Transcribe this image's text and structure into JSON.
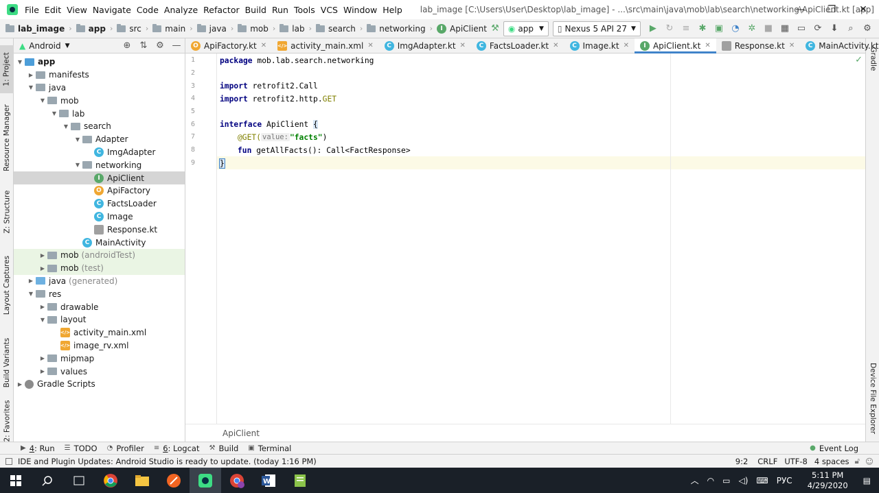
{
  "titlebar": {
    "menu": [
      "File",
      "Edit",
      "View",
      "Navigate",
      "Code",
      "Analyze",
      "Refactor",
      "Build",
      "Run",
      "Tools",
      "VCS",
      "Window",
      "Help"
    ],
    "window_title": "lab_image [C:\\Users\\User\\Desktop\\lab_image] - ...\\src\\main\\java\\mob\\lab\\search\\networking\\ApiClient.kt [app]",
    "controls": {
      "minimize": "—",
      "restore": "❐",
      "close": "✕"
    }
  },
  "navbar": {
    "crumbs": [
      "lab_image",
      "app",
      "src",
      "main",
      "java",
      "mob",
      "lab",
      "search",
      "networking",
      "ApiClient"
    ],
    "run_config": "app",
    "device": "Nexus 5 API 27"
  },
  "left_stripe": [
    "1: Project",
    "Resource Manager",
    "Z: Structure",
    "Layout Captures",
    "Build Variants",
    "2: Favorites"
  ],
  "right_stripe": [
    "Gradle",
    "Device File Explorer"
  ],
  "project_panel": {
    "view": "Android",
    "tree": [
      {
        "label": "app",
        "bold": true
      },
      {
        "label": "manifests"
      },
      {
        "label": "java"
      },
      {
        "label": "mob"
      },
      {
        "label": "lab"
      },
      {
        "label": "search"
      },
      {
        "label": "Adapter"
      },
      {
        "label": "ImgAdapter"
      },
      {
        "label": "networking"
      },
      {
        "label": "ApiClient"
      },
      {
        "label": "ApiFactory"
      },
      {
        "label": "FactsLoader"
      },
      {
        "label": "Image"
      },
      {
        "label": "Response.kt"
      },
      {
        "label": "MainActivity"
      },
      {
        "label": "mob",
        "suffix": "(androidTest)"
      },
      {
        "label": "mob",
        "suffix": "(test)"
      },
      {
        "label": "java",
        "suffix": "(generated)"
      },
      {
        "label": "res"
      },
      {
        "label": "drawable"
      },
      {
        "label": "layout"
      },
      {
        "label": "activity_main.xml"
      },
      {
        "label": "image_rv.xml"
      },
      {
        "label": "mipmap"
      },
      {
        "label": "values"
      },
      {
        "label": "Gradle Scripts"
      }
    ]
  },
  "tabs": [
    "ApiFactory.kt",
    "activity_main.xml",
    "ImgAdapter.kt",
    "FactsLoader.kt",
    "Image.kt",
    "ApiClient.kt",
    "Response.kt",
    "MainActivity.kt"
  ],
  "active_tab": "ApiClient.kt",
  "editor": {
    "line_numbers": [
      "1",
      "2",
      "3",
      "4",
      "5",
      "6",
      "7",
      "8",
      "9"
    ],
    "lines": {
      "l1_kw": "package",
      "l1_rest": " mob.lab.search.networking",
      "l3_kw": "import",
      "l3_rest": " retrofit2.Call",
      "l4_kw": "import",
      "l4_rest": " retrofit2.http.",
      "l4_get": "GET",
      "l6_kw": "interface",
      "l6_rest": " ApiClient ",
      "l6_brace": "{",
      "l7_ann": "@GET(",
      "l7_hint": "value:",
      "l7_str": "\"facts\"",
      "l7_close": ")",
      "l8_kw": "fun",
      "l8_rest": " getAllFacts(): Call<FactResponse>",
      "l9_brace": "}"
    },
    "breadcrumb": "ApiClient"
  },
  "bottom_tools": [
    {
      "key": "4",
      "label": ": Run"
    },
    {
      "key": "",
      "label": "TODO"
    },
    {
      "key": "",
      "label": "Profiler"
    },
    {
      "key": "6",
      "label": ": Logcat"
    },
    {
      "key": "",
      "label": "Build"
    },
    {
      "key": "",
      "label": "Terminal"
    }
  ],
  "event_log": "Event Log",
  "status": {
    "message": "IDE and Plugin Updates: Android Studio is ready to update. (today 1:16 PM)",
    "position": "9:2",
    "line_sep": "CRLF",
    "encoding": "UTF-8",
    "indent": "4 spaces"
  },
  "taskbar": {
    "lang": "РУС",
    "time": "5:11 PM",
    "date": "4/29/2020"
  }
}
